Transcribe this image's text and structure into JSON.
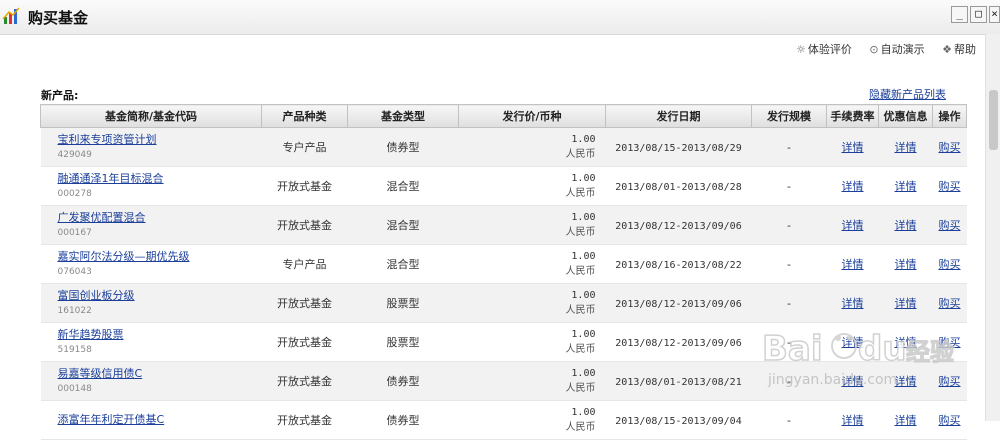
{
  "window": {
    "title": "购买基金",
    "buttons": {
      "minimize": "_",
      "restore": "□",
      "close": "×"
    }
  },
  "helpbar": {
    "items": [
      {
        "label": "体验评价",
        "icon": "gear-icon"
      },
      {
        "label": "自动演示",
        "icon": "play-icon"
      },
      {
        "label": "帮助",
        "icon": "help-icon"
      }
    ]
  },
  "section": {
    "title": "新产品:",
    "hide_link": "隐藏新产品列表"
  },
  "table": {
    "headers": [
      "基金简称/基金代码",
      "产品种类",
      "基金类型",
      "发行价/币种",
      "发行日期",
      "发行规模",
      "手续费率",
      "优惠信息",
      "操作"
    ],
    "rows": [
      {
        "name": "宝利来专项资管计划",
        "code": "429049",
        "category": "专户产品",
        "type": "债券型",
        "price": "1.00",
        "currency": "人民币",
        "date": "2013/08/15-2013/08/29",
        "scale": "-",
        "fee": "详情",
        "promo": "详情",
        "action": "购买"
      },
      {
        "name": "融通通泽1年目标混合",
        "code": "000278",
        "category": "开放式基金",
        "type": "混合型",
        "price": "1.00",
        "currency": "人民币",
        "date": "2013/08/01-2013/08/28",
        "scale": "-",
        "fee": "详情",
        "promo": "详情",
        "action": "购买"
      },
      {
        "name": "广发聚优配置混合",
        "code": "000167",
        "category": "开放式基金",
        "type": "混合型",
        "price": "1.00",
        "currency": "人民币",
        "date": "2013/08/12-2013/09/06",
        "scale": "-",
        "fee": "详情",
        "promo": "详情",
        "action": "购买"
      },
      {
        "name": "嘉实阿尔法分级—期优先级",
        "code": "076043",
        "category": "专户产品",
        "type": "混合型",
        "price": "1.00",
        "currency": "人民币",
        "date": "2013/08/16-2013/08/22",
        "scale": "-",
        "fee": "详情",
        "promo": "详情",
        "action": "购买"
      },
      {
        "name": "富国创业板分级",
        "code": "161022",
        "category": "开放式基金",
        "type": "股票型",
        "price": "1.00",
        "currency": "人民币",
        "date": "2013/08/12-2013/09/06",
        "scale": "-",
        "fee": "详情",
        "promo": "详情",
        "action": "购买"
      },
      {
        "name": "新华趋势股票",
        "code": "519158",
        "category": "开放式基金",
        "type": "股票型",
        "price": "1.00",
        "currency": "人民币",
        "date": "2013/08/12-2013/09/06",
        "scale": "-",
        "fee": "详情",
        "promo": "详情",
        "action": "购买"
      },
      {
        "name": "易嘉等级信用债C",
        "code": "000148",
        "category": "开放式基金",
        "type": "债券型",
        "price": "1.00",
        "currency": "人民币",
        "date": "2013/08/01-2013/08/21",
        "scale": "-",
        "fee": "详情",
        "promo": "详情",
        "action": "购买"
      },
      {
        "name": "添富年年利定开债基C",
        "code": "",
        "category": "开放式基金",
        "type": "债券型",
        "price": "1.00",
        "currency": "人民币",
        "date": "2013/08/15-2013/09/04",
        "scale": "-",
        "fee": "详情",
        "promo": "详情",
        "action": "购买"
      }
    ]
  },
  "watermark": {
    "brand": "Bai du 经验",
    "url": "jingyan.baidu.com"
  },
  "colors": {
    "link": "#1b3f9a",
    "header_bg": "#e4e4e4",
    "alt_row": "#f2f2f2"
  }
}
